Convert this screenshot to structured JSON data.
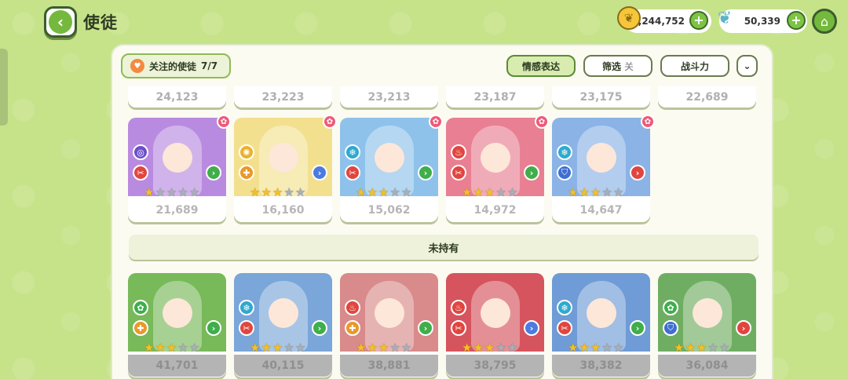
{
  "header": {
    "title": "使徒",
    "coins": "1,244,752",
    "seeds": "50,339"
  },
  "toolbar": {
    "favorites_label": "关注的使徒",
    "favorites_count": "7/7",
    "emotion_label": "情感表达",
    "filter_label": "筛选",
    "filter_state": "关",
    "power_label": "战斗力"
  },
  "partial_row": [
    "24,123",
    "23,223",
    "23,213",
    "23,187",
    "23,175",
    "22,689"
  ],
  "owned": [
    {
      "power": "21,689",
      "stars": 1,
      "bg": "#b98be0",
      "attr_top": "#6b4fc9",
      "attr_top_glyph": "◎",
      "attr_bottom": "#e0463f",
      "attr_bottom_glyph": "✂",
      "chev": "#3fae4b"
    },
    {
      "power": "16,160",
      "stars": 3,
      "bg": "#f3e08f",
      "attr_top": "#e9b22b",
      "attr_top_glyph": "✺",
      "attr_bottom": "#e9982b",
      "attr_bottom_glyph": "✚",
      "chev": "#4c7be0"
    },
    {
      "power": "15,062",
      "stars": 3,
      "bg": "#8ec2ea",
      "attr_top": "#2fa9cf",
      "attr_top_glyph": "❄",
      "attr_bottom": "#e0463f",
      "attr_bottom_glyph": "✂",
      "chev": "#3fae4b"
    },
    {
      "power": "14,972",
      "stars": 3,
      "bg": "#e97f92",
      "attr_top": "#e0463f",
      "attr_top_glyph": "♨",
      "attr_bottom": "#e0463f",
      "attr_bottom_glyph": "✂",
      "chev": "#3fae4b"
    },
    {
      "power": "14,647",
      "stars": 3,
      "bg": "#8bb3e6",
      "attr_top": "#2fa9cf",
      "attr_top_glyph": "❄",
      "attr_bottom": "#3f6fd0",
      "attr_bottom_glyph": "⛉",
      "chev": "#e0463f"
    }
  ],
  "section_unowned": "未持有",
  "unowned": [
    {
      "power": "41,701",
      "stars": 3,
      "bg": "#78b95a",
      "attr_top": "#3fae4b",
      "attr_top_glyph": "✿",
      "attr_bottom": "#e9982b",
      "attr_bottom_glyph": "✚",
      "chev": "#3fae4b"
    },
    {
      "power": "40,115",
      "stars": 3,
      "bg": "#7aa6d9",
      "attr_top": "#2fa9cf",
      "attr_top_glyph": "❄",
      "attr_bottom": "#e0463f",
      "attr_bottom_glyph": "✂",
      "chev": "#3fae4b"
    },
    {
      "power": "38,881",
      "stars": 3,
      "bg": "#d98a8a",
      "attr_top": "#e0463f",
      "attr_top_glyph": "♨",
      "attr_bottom": "#e9982b",
      "attr_bottom_glyph": "✚",
      "chev": "#3fae4b"
    },
    {
      "power": "38,795",
      "stars": 3,
      "bg": "#d6545e",
      "attr_top": "#e0463f",
      "attr_top_glyph": "♨",
      "attr_bottom": "#e0463f",
      "attr_bottom_glyph": "✂",
      "chev": "#4c7be0"
    },
    {
      "power": "38,382",
      "stars": 3,
      "bg": "#6f9bd6",
      "attr_top": "#2fa9cf",
      "attr_top_glyph": "❄",
      "attr_bottom": "#e0463f",
      "attr_bottom_glyph": "✂",
      "chev": "#3fae4b"
    },
    {
      "power": "36,084",
      "stars": 3,
      "bg": "#6fae62",
      "attr_top": "#3fae4b",
      "attr_top_glyph": "✿",
      "attr_bottom": "#3f6fd0",
      "attr_bottom_glyph": "⛉",
      "chev": "#e0463f"
    }
  ]
}
